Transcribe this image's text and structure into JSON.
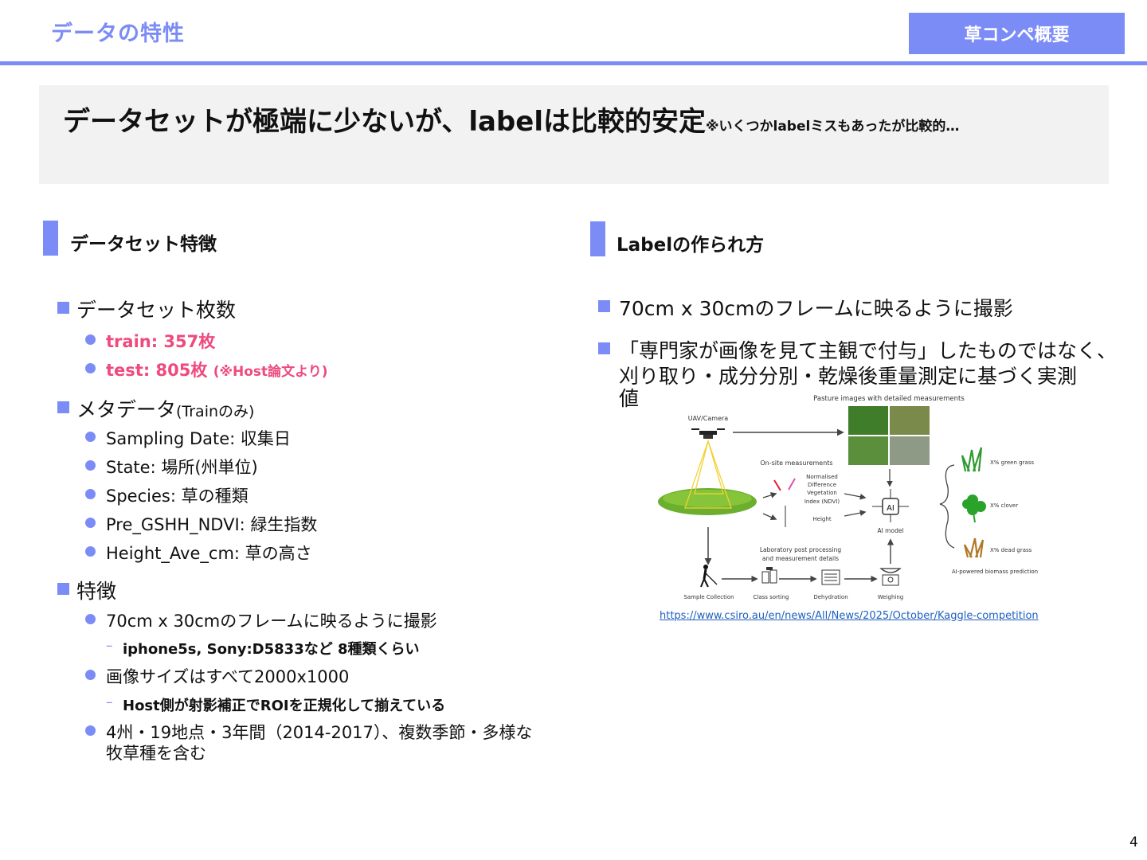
{
  "header": {
    "title": "データの特性",
    "tag": "草コンペ概要"
  },
  "lead": {
    "main": "データセットが極端に少ないが、labelは比較的安定",
    "note": "※いくつかlabelミスもあったが比較的…"
  },
  "left": {
    "title": "データセット特徴",
    "count_heading": "データセット枚数",
    "train": "train: 357枚",
    "test_main": "test: 805枚 ",
    "test_note": "(※Host論文より)",
    "meta_heading": "メタデータ",
    "meta_note": "(Trainのみ)",
    "meta_items": [
      "Sampling Date: 収集日",
      "State: 場所(州単位)",
      "Species: 草の種類",
      "Pre_GSHH_NDVI: 緑生指数",
      "Height_Ave_cm: 草の高さ"
    ],
    "feature_heading": "特徴",
    "f1": "70cm x 30cmのフレームに映るように撮影",
    "f1_sub": "iphone5s, Sony:D5833など 8種類くらい",
    "f2": "画像サイズはすべて2000x1000",
    "f2_sub": "Host側が射影補正でROIを正規化して揃えている",
    "f3_line1": "4州・19地点・3年間（2014-2017）、複数季節・多様な",
    "f3_line2": "牧草種を含む"
  },
  "right": {
    "title": "Labelの作られ方",
    "b1": "70cm x 30cmのフレームに映るように撮影",
    "b2_line1": "「専門家が画像を見て主観で付与」したものではなく、",
    "b2_line2": "刈り取り・成分分別・乾燥後重量測定に基づく実測",
    "b2_line3": "値",
    "figure": {
      "top_label": "Pasture images with detailed measurements",
      "uav": "UAV/Camera",
      "onsite": "On-site measurements",
      "ndvi": [
        "Normalised",
        "Difference",
        "Vegetation",
        "Index (NDVI)"
      ],
      "height": "Height",
      "ai_badge": "AI",
      "ai_model": "AI model",
      "lab": [
        "Laboratory post processing",
        "and measurement details"
      ],
      "green": "X% green grass",
      "clover": "X% clover",
      "dead": "X% dead grass",
      "pred": "AI-powered biomass prediction",
      "steps": [
        "Sample Collection",
        "Class sorting",
        "Dehydration",
        "Weighing"
      ]
    },
    "link": "https://www.csiro.au/en/news/All/News/2025/October/Kaggle-competition"
  },
  "page_number": "4"
}
